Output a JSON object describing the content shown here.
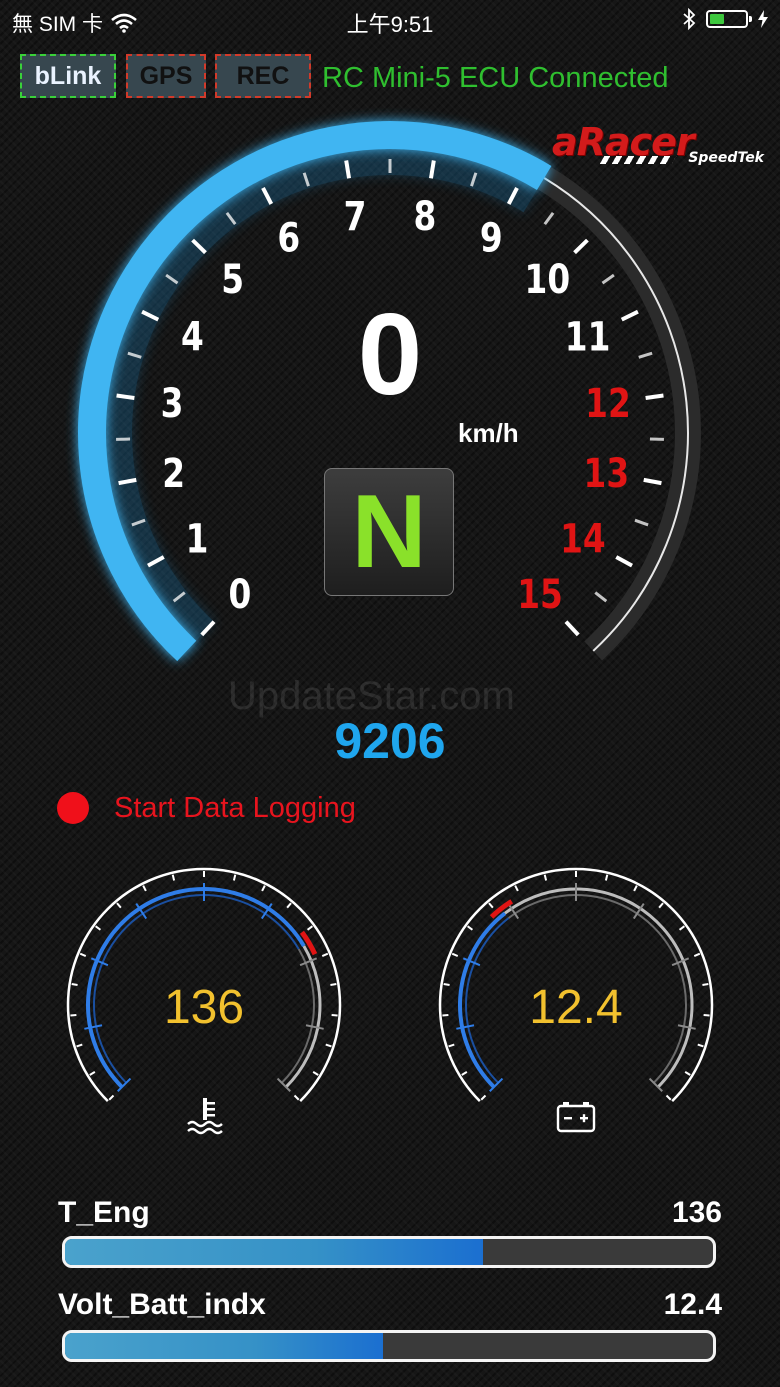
{
  "status_bar": {
    "carrier": "無 SIM 卡",
    "time": "上午9:51"
  },
  "header": {
    "chips": [
      {
        "label": "bLink",
        "state": "on"
      },
      {
        "label": "GPS",
        "state": "off"
      },
      {
        "label": "REC",
        "state": "off"
      }
    ],
    "connection_text": "RC Mini-5 ECU Connected"
  },
  "logo": {
    "brand": "aRacer",
    "sub": "SpeedTek"
  },
  "tachometer": {
    "tick_labels": [
      "0",
      "1",
      "2",
      "3",
      "4",
      "5",
      "6",
      "7",
      "8",
      "9",
      "10",
      "11",
      "12",
      "13",
      "14",
      "15"
    ],
    "redline_from": 12,
    "rpm": 9206,
    "speed": "0",
    "speed_unit": "km/h",
    "gear": "N",
    "colors": {
      "arc": "#3fb5f2",
      "redline": "#e01414"
    }
  },
  "rpm_display": "9206",
  "logging": {
    "label": "Start Data Logging",
    "color": "#f0101a"
  },
  "small_gauges": [
    {
      "name": "engine-temperature",
      "value": "136",
      "icon": "coolant-temperature-icon",
      "level": 0.72
    },
    {
      "name": "battery-voltage",
      "value": "12.4",
      "icon": "battery-icon",
      "level": 0.36
    }
  ],
  "bars": [
    {
      "label": "T_Eng",
      "value": "136",
      "fill": 0.645
    },
    {
      "label": "Volt_Batt_indx",
      "value": "12.4",
      "fill": 0.49
    }
  ],
  "watermark": "UpdateStar.com"
}
